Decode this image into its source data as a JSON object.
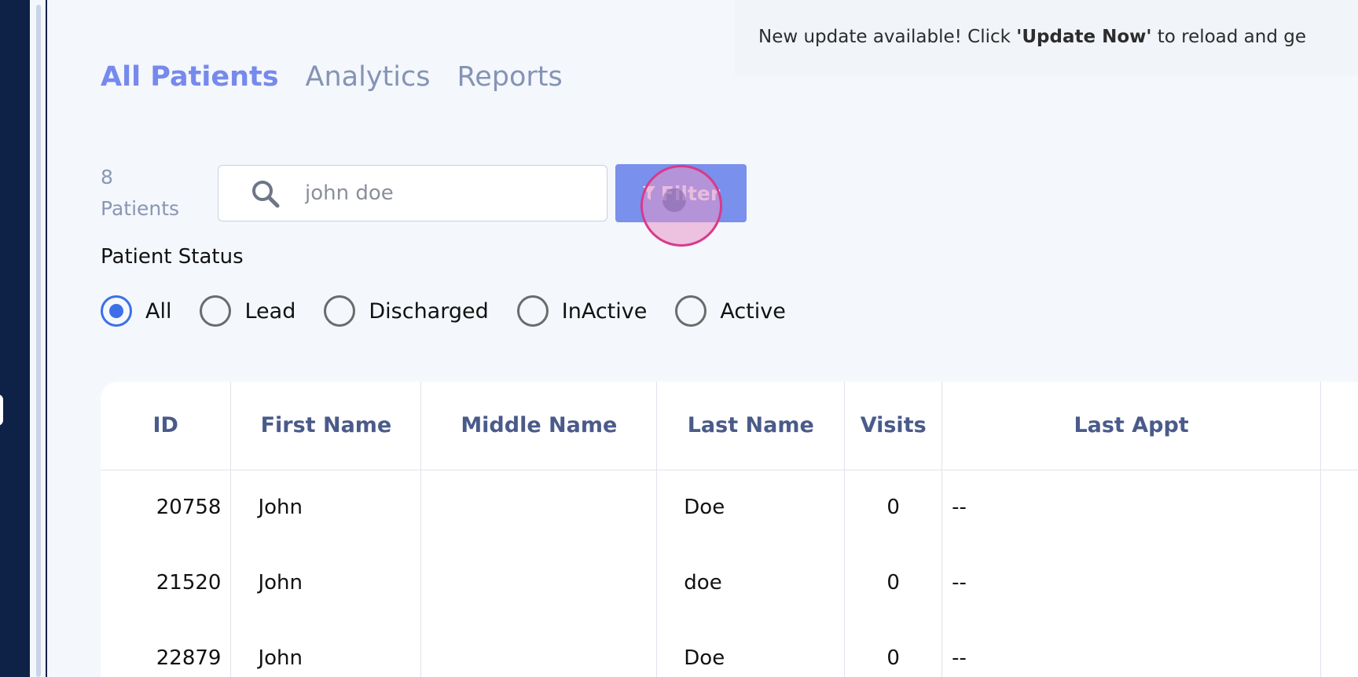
{
  "banner": {
    "prefix": "New update available! Click ",
    "highlight": "'Update Now'",
    "suffix": " to reload and ge"
  },
  "tabs": [
    {
      "label": "All Patients",
      "active": true
    },
    {
      "label": "Analytics",
      "active": false
    },
    {
      "label": "Reports",
      "active": false
    }
  ],
  "patient_count": {
    "number": "8",
    "label": "Patients"
  },
  "search": {
    "value": "john doe",
    "placeholder": ""
  },
  "filter_button": {
    "label": "Filter"
  },
  "status": {
    "label": "Patient Status",
    "options": [
      {
        "label": "All",
        "checked": true
      },
      {
        "label": "Lead",
        "checked": false
      },
      {
        "label": "Discharged",
        "checked": false
      },
      {
        "label": "InActive",
        "checked": false
      },
      {
        "label": "Active",
        "checked": false
      }
    ]
  },
  "table": {
    "columns": [
      "ID",
      "First Name",
      "Middle Name",
      "Last Name",
      "Visits",
      "Last Appt"
    ],
    "rows": [
      [
        "20758",
        "John",
        "",
        "Doe",
        "0",
        "--"
      ],
      [
        "21520",
        "John",
        "",
        "doe",
        "0",
        "--"
      ],
      [
        "22879",
        "John",
        "",
        "Doe",
        "0",
        "--"
      ]
    ]
  },
  "colors": {
    "accent": "#7689ec",
    "tab_inactive": "#8494b4",
    "sidebar": "#0e2147",
    "radio_checked": "#3c6fe8",
    "header_text": "#4a5a8a"
  }
}
